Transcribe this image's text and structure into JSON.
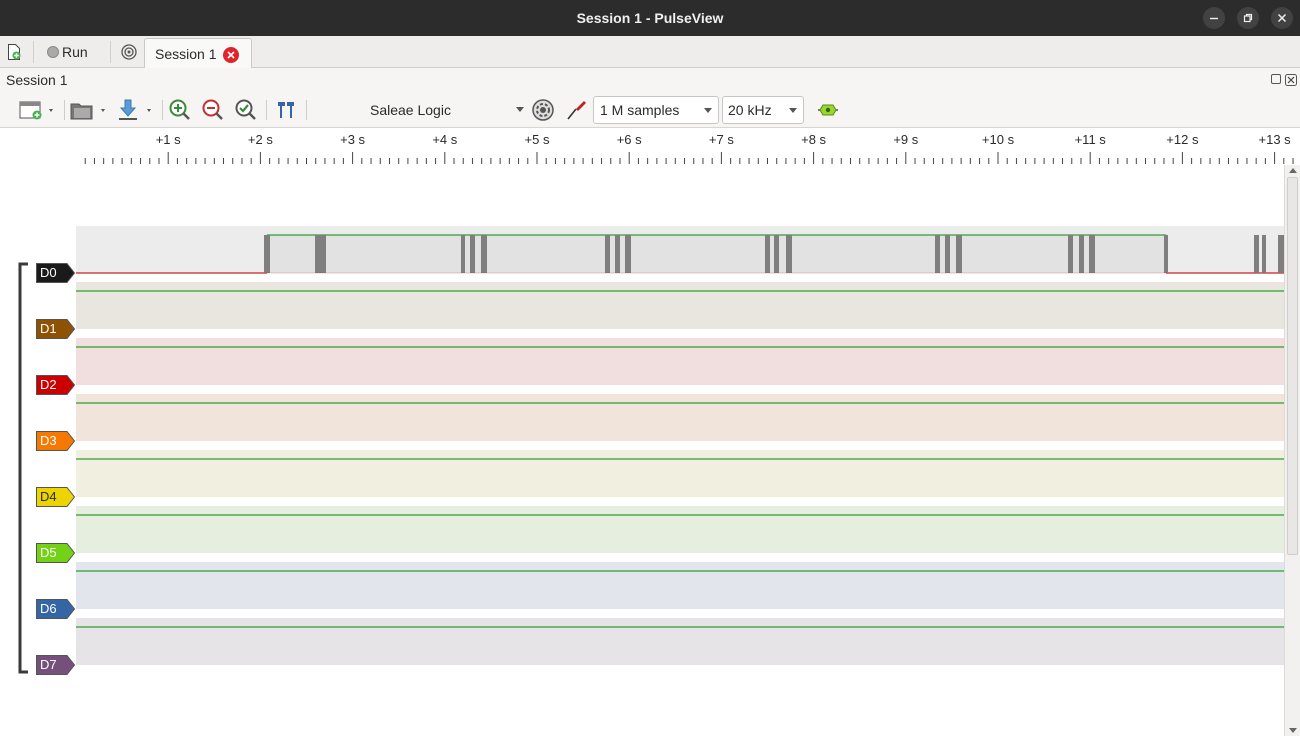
{
  "window": {
    "title": "Session 1 - PulseView"
  },
  "tabbar": {
    "run_label": "Run",
    "session_tab_label": "Session 1"
  },
  "dock": {
    "title": "Session 1"
  },
  "toolbar": {
    "device": "Saleae Logic",
    "samples": "1 M samples",
    "samplerate": "20 kHz"
  },
  "ruler": {
    "ticks": [
      "+1 s",
      "+2 s",
      "+3 s",
      "+4 s",
      "+5 s",
      "+6 s",
      "+7 s",
      "+8 s",
      "+9 s",
      "+10 s",
      "+11 s",
      "+12 s",
      "+13 s"
    ]
  },
  "channels": [
    {
      "name": "D0",
      "color": "#1a1a1a",
      "bg": "#ececec"
    },
    {
      "name": "D1",
      "color": "#8f5202",
      "bg": "#e9e5df"
    },
    {
      "name": "D2",
      "color": "#cc0000",
      "bg": "#f1dfe0"
    },
    {
      "name": "D3",
      "color": "#f57900",
      "bg": "#f1e5db"
    },
    {
      "name": "D4",
      "color": "#edd400",
      "bg": "#f1efdf"
    },
    {
      "name": "D5",
      "color": "#73d216",
      "bg": "#e6eee0"
    },
    {
      "name": "D6",
      "color": "#3465a4",
      "bg": "#e2e6ec"
    },
    {
      "name": "D7",
      "color": "#75507b",
      "bg": "#e7e4e8"
    }
  ],
  "colors": {
    "high_trace": "#2e9f2e",
    "low_trace": "#cc2020",
    "edge_gray": "#7f7f7f"
  }
}
